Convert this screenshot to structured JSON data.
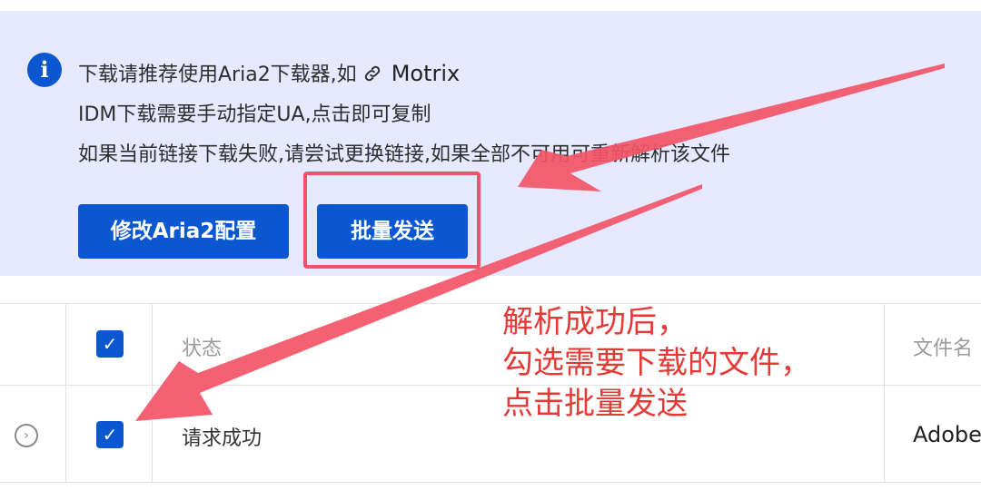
{
  "alert": {
    "line1": "下载请推荐使用Aria2下载器,如",
    "link_text": "Motrix",
    "line2": "IDM下载需要手动指定UA,点击即可复制",
    "line3": "如果当前链接下载失败,请尝试更换链接,如果全部不可用可重新解析该文件",
    "buttons": {
      "aria2_config": "修改Aria2配置",
      "batch_send": "批量发送"
    }
  },
  "table": {
    "header": {
      "status": "状态",
      "filename": "文件名"
    },
    "rows": [
      {
        "checked": true,
        "status": "请求成功",
        "filename": "Adobe"
      }
    ]
  },
  "annotation": {
    "lines": [
      "解析成功后，",
      "勾选需要下载的文件，",
      "点击批量发送"
    ],
    "color": "#e53935"
  },
  "colors": {
    "accent": "#0b57d0",
    "alert_bg": "#e6e9ff",
    "highlight": "#f25467"
  }
}
